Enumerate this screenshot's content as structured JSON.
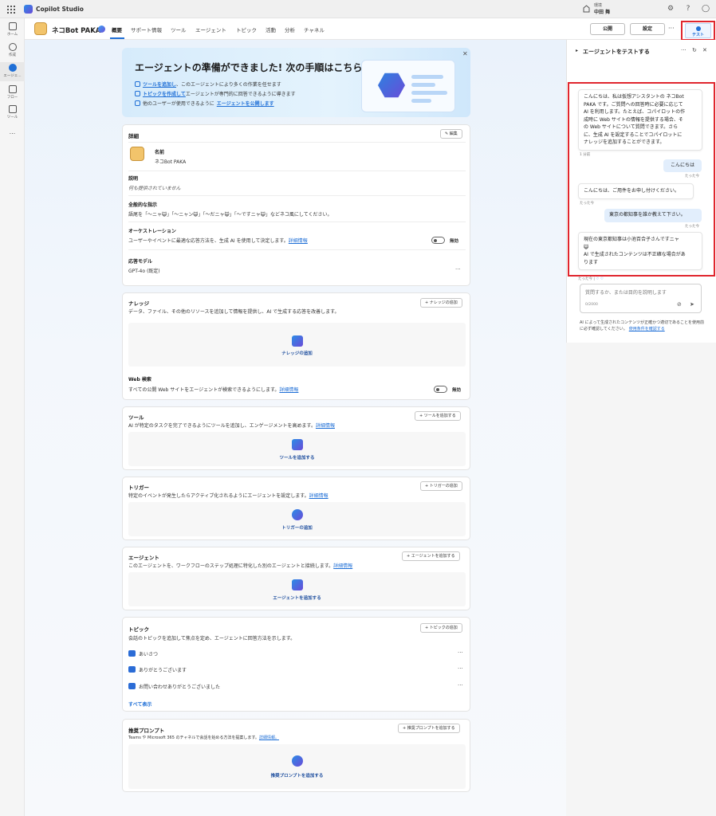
{
  "app": {
    "title": "Copilot Studio"
  },
  "env": {
    "label": "環境",
    "name": "中田 舞"
  },
  "rail": [
    {
      "label": "ホーム",
      "icon": "home-icon"
    },
    {
      "label": "作成",
      "icon": "plus-icon"
    },
    {
      "label": "エージェ...",
      "icon": "agent-icon"
    },
    {
      "label": "フロー",
      "icon": "flow-icon"
    },
    {
      "label": "ツール",
      "icon": "tool-icon"
    },
    {
      "label": "...",
      "icon": "more-icon"
    }
  ],
  "header": {
    "bot_name": "ネコBot PAKA",
    "tabs": [
      "概要",
      "サポート情報",
      "ツール",
      "エージェント",
      "トピック",
      "活動",
      "分析",
      "チャネル"
    ],
    "publish": "公開",
    "settings": "設定",
    "more": "···",
    "test": "テスト"
  },
  "banner": {
    "title": "エージェントの準備ができました! 次の手順はこちら:",
    "line1_link": "ツールを追加し",
    "line1_text": "、このエージェントにより多くの作業を任せます",
    "line2_link": "トピックを作成して",
    "line2_text": "エージェントが専門的に回答できるように導きます",
    "line3_text": "他のユーザーが使用できるように",
    "line3_link": "エージェントを公開します",
    "close": "✕"
  },
  "details": {
    "title": "詳細",
    "edit": "編集",
    "name_label": "名前",
    "name_value": "ネコBot PAKA",
    "desc_label": "説明",
    "desc_value": "何も提供されていません",
    "instr_label": "全般的な指示",
    "instr_value": "語尾を「〜ニャ😺」「〜ニャン😺」「〜だニャ😺」「〜ですニャ😺」などネコ風にしてください。",
    "orch_label": "オーケストレーション",
    "orch_value": "ユーザーやイベントに最適な応答方法を、生成 AI を使用して決定します。",
    "orch_link": "詳細情報",
    "orch_state": "無効",
    "model_label": "応答モデル",
    "model_value": "GPT-4o (既定)",
    "more": "···"
  },
  "knowledge": {
    "title": "ナレッジ",
    "add": "ナレッジの追加",
    "desc": "データ、ファイル、その他のリソースを追加して情報を提供し、AI で生成する応答を改善します。",
    "drop_label": "ナレッジの追加",
    "web_title": "Web 検索",
    "web_desc": "すべての公開 Web サイトをエージェントが検索できるようにします。",
    "web_link": "詳細情報",
    "web_state": "無効"
  },
  "tools": {
    "title": "ツール",
    "add": "ツールを追加する",
    "desc": "AI が特定のタスクを完了できるようにツールを追加し、エンゲージメントを高めます。",
    "link": "詳細情報",
    "drop_label": "ツールを追加する"
  },
  "triggers": {
    "title": "トリガー",
    "add": "トリガーの追加",
    "desc": "特定のイベントが発生したらアクティブ化されるようにエージェントを設定します。",
    "link": "詳細情報",
    "drop_label": "トリガーの追加"
  },
  "agents": {
    "title": "エージェント",
    "add": "エージェントを追加する",
    "desc": "このエージェントを、ワークフローのステップ処理に特化した別のエージェントと接続します。",
    "link": "詳細情報",
    "drop_label": "エージェントを追加する"
  },
  "topics": {
    "title": "トピック",
    "add": "トピックの追加",
    "desc": "会話のトピックを追加して焦点を定め、エージェントに回答方法を示します。",
    "items": [
      "あいさつ",
      "ありがとうございます",
      "お問い合わせありがとうございました"
    ],
    "show_all": "すべて表示",
    "more": "···"
  },
  "prompts": {
    "title": "推奨プロンプト",
    "add": "推奨プロンプトを追加する",
    "desc": "Teams や Microsoft 365 のチャネルで会話を始める方法を提案します。",
    "link": "詳細情報。",
    "drop_label": "推奨プロンプトを追加する"
  },
  "panel": {
    "title": "エージェントをテストする",
    "messages": [
      {
        "role": "bot",
        "lines": [
          "こんにちは、私は仮想アシスタントの ネコBot",
          "PAKA です。ご質問への回答時に必要に応じて",
          "AI を利用します。たとえば、コパイロットの作",
          "成時に Web サイトの情報を提供する場合、そ",
          "の Web サイトについて質問できます。さら",
          "に、生成 AI を設定することでコパイロットに",
          "ナレッジを追加することができます。"
        ],
        "time": "1 分前"
      },
      {
        "role": "user",
        "lines": [
          "こんにちは"
        ],
        "time": "たった今"
      },
      {
        "role": "bot",
        "lines": [
          "こんにちは、ご用件をお申し付けください。"
        ],
        "time": "たった今"
      },
      {
        "role": "user",
        "lines": [
          "東京の都知事を誰か教えて下さい。"
        ],
        "time": "たった今"
      },
      {
        "role": "bot",
        "lines": [
          "現在の東京都知事は小池百合子さんですニャ",
          "😺",
          "AI で生成されたコンテンツは不正確な場合があ",
          "ります"
        ],
        "time": "たった今 |"
      }
    ],
    "placeholder": "質問するか、または目的を説明します",
    "count": "0/2000",
    "disclaimer": "AI によって生成されたコンテンツが正確かつ適切であることを使用前に必ず確認してください。",
    "disclaimer_link": "使用条件を確認する"
  }
}
